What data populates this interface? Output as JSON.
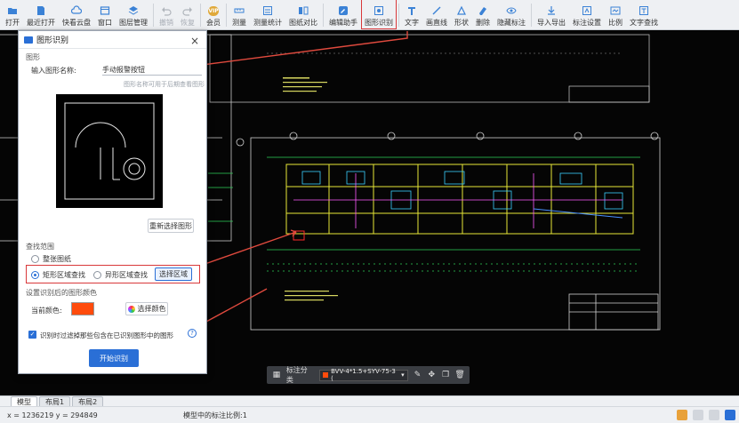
{
  "toolbar": {
    "items": [
      {
        "label": "打开",
        "icon": "folder-open-icon"
      },
      {
        "label": "最近打开",
        "icon": "recent-files-icon"
      },
      {
        "label": "快看云盘",
        "icon": "cloud-icon"
      },
      {
        "label": "窗口",
        "icon": "window-icon"
      },
      {
        "label": "图层管理",
        "icon": "layers-icon"
      },
      {
        "label": "撤销",
        "icon": "undo-icon"
      },
      {
        "label": "恢复",
        "icon": "redo-icon"
      },
      {
        "label": "会员",
        "icon": "vip-icon"
      },
      {
        "label": "测量",
        "icon": "measure-icon"
      },
      {
        "label": "测量统计",
        "icon": "measure-stats-icon"
      },
      {
        "label": "图纸对比",
        "icon": "drawing-compare-icon"
      },
      {
        "label": "编辑助手",
        "icon": "edit-assistant-icon"
      },
      {
        "label": "图形识别",
        "icon": "shape-recognition-icon"
      },
      {
        "label": "文字",
        "icon": "text-icon"
      },
      {
        "label": "画直线",
        "icon": "line-icon"
      },
      {
        "label": "形状",
        "icon": "shape-icon"
      },
      {
        "label": "删除",
        "icon": "delete-icon"
      },
      {
        "label": "隐藏标注",
        "icon": "hide-annotation-icon"
      },
      {
        "label": "导入导出",
        "icon": "import-export-icon"
      },
      {
        "label": "标注设置",
        "icon": "annotation-settings-icon"
      },
      {
        "label": "比例",
        "icon": "scale-icon"
      },
      {
        "label": "文字查找",
        "icon": "text-search-icon"
      }
    ],
    "vip_badge": "VIP"
  },
  "dialog": {
    "title": "图形识别",
    "close": "×",
    "section_shape": "图形",
    "name_label": "输入图形名称:",
    "name_value": "手动报警按钮",
    "name_hint": "图形名称可用于后期查看图形",
    "reselect_button": "重新选择图形",
    "section_range": "查找范围",
    "radio_whole": "整张图纸",
    "radio_rect": "矩形区域查找",
    "radio_irregular": "异形区域查找",
    "select_area_button": "选择区域",
    "section_color": "设置识别后的图形颜色",
    "current_color_label": "当前颜色:",
    "current_color": "#ff4b0c",
    "choose_color_button": "选择颜色",
    "checkbox_label": "识别时过滤掉那些包含在已识别图形中的图形",
    "help": "?",
    "start_button": "开始识别"
  },
  "floatbar": {
    "label": "标注分类",
    "layer": "BVV-4*1.5+SYV-75-3 (",
    "layer_color": "#ff4b0c"
  },
  "tabs": [
    "模型",
    "布局1",
    "布局2"
  ],
  "status": {
    "coords": "x = 1236219  y = 294849",
    "scale": "模型中的标注比例:1"
  },
  "colors": {
    "highlight": "#d9383a",
    "accent": "#2a6fd6"
  }
}
